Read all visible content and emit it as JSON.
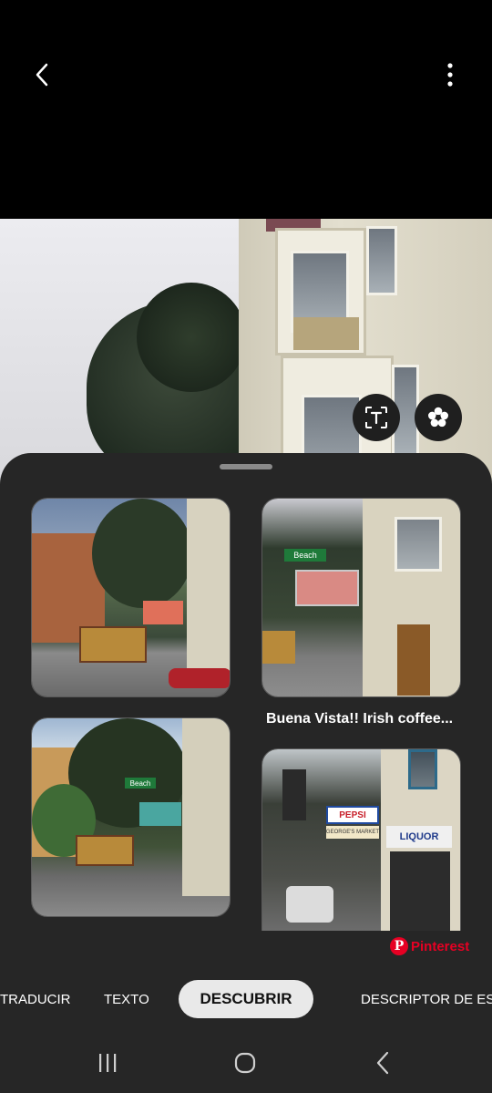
{
  "topbar": {
    "back_icon": "chevron-left-icon",
    "more_icon": "more-vertical-icon"
  },
  "photo": {
    "text_button_icon": "text-scan-icon",
    "discover_button_icon": "flower-icon"
  },
  "results": {
    "cards": [
      {
        "scene": "cable car street corner"
      },
      {
        "scene": "Buena Vista sign"
      },
      {
        "scene": "street corner with trees"
      },
      {
        "scene": "Pepsi liquor store"
      }
    ],
    "caption": "Buena Vista!!   Irish coffee...",
    "source_label": "Pinterest",
    "source_logo": "P",
    "source_color": "#e60023"
  },
  "signs": {
    "beach": "Beach",
    "pepsi": "PEPSI",
    "store": "GEORGE'S MARKET",
    "liquor": "LIQUOR"
  },
  "tabs": {
    "items": [
      "TRADUCIR",
      "TEXTO",
      "DESCUBRIR",
      "DESCRIPTOR DE ESC"
    ],
    "active": "DESCUBRIR"
  },
  "navbar": {
    "recent_icon": "recent-apps-icon",
    "home_icon": "home-icon",
    "back_icon": "back-icon"
  }
}
